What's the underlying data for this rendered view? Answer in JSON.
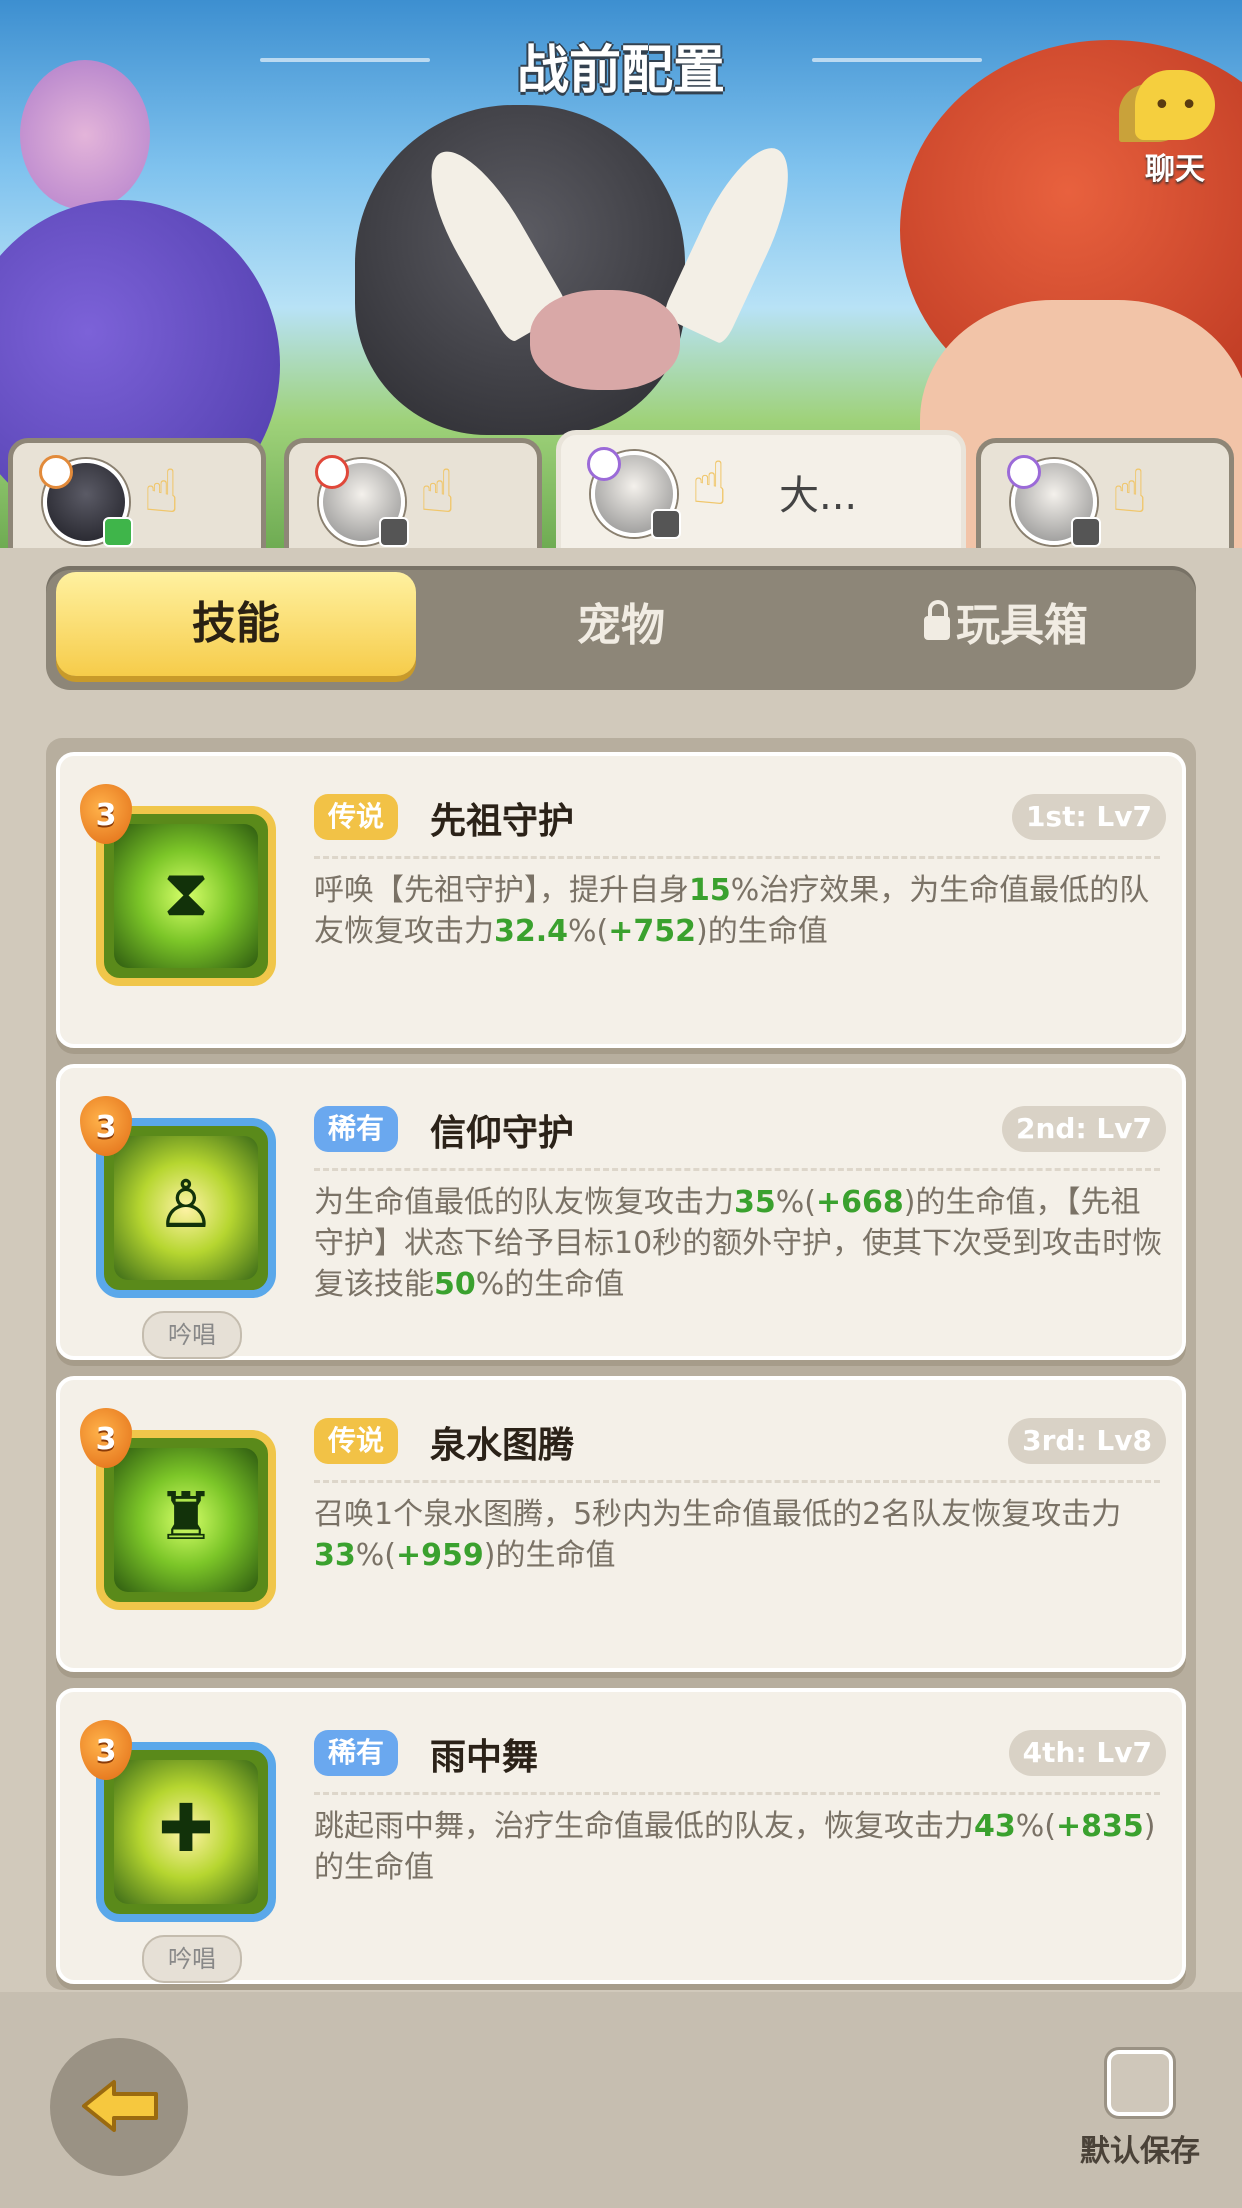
{
  "header": {
    "title": "战前配置",
    "chat_label": "聊天"
  },
  "hero_tabs": [
    {
      "name": ""
    },
    {
      "name": ""
    },
    {
      "name": "大..."
    },
    {
      "name": ""
    }
  ],
  "segment": {
    "skills": "技能",
    "pets": "宠物",
    "toybox": "玩具箱",
    "active": "技能"
  },
  "skills": [
    {
      "level": "3",
      "rarity": "传说",
      "name": "先祖守护",
      "slot": "1st: Lv7",
      "cast_tag": "",
      "desc": [
        "呼唤【先祖守护】，提升自身",
        {
          "g": "15"
        },
        "%治疗效果，为生命值最低的队友恢复攻击力",
        {
          "g": "32.4"
        },
        "%(",
        {
          "g": "+752"
        },
        ")的生命值"
      ]
    },
    {
      "level": "3",
      "rarity": "稀有",
      "name": "信仰守护",
      "slot": "2nd: Lv7",
      "cast_tag": "吟唱",
      "desc": [
        "为生命值最低的队友恢复攻击力",
        {
          "g": "35"
        },
        "%(",
        {
          "g": "+668"
        },
        ")的生命值，【先祖守护】状态下给予目标10秒的额外守护，使其下次受到攻击时恢复该技能",
        {
          "g": "50"
        },
        "%的生命值"
      ]
    },
    {
      "level": "3",
      "rarity": "传说",
      "name": "泉水图腾",
      "slot": "3rd: Lv8",
      "cast_tag": "",
      "desc": [
        "召唤1个泉水图腾，5秒内为生命值最低的2名队友恢复攻击力",
        {
          "g": "33"
        },
        "%(",
        {
          "g": "+959"
        },
        ")的生命值"
      ]
    },
    {
      "level": "3",
      "rarity": "稀有",
      "name": "雨中舞",
      "slot": "4th: Lv7",
      "cast_tag": "吟唱",
      "desc": [
        "跳起雨中舞，治疗生命值最低的队友，恢复攻击力",
        {
          "g": "43"
        },
        "%(",
        {
          "g": "+835"
        },
        ")的生命值"
      ]
    }
  ],
  "footer": {
    "save_label": "默认保存"
  },
  "colors": {
    "accent_yellow": "#f6cc4a",
    "legend": "#f2c246",
    "rare": "#6aa8ef",
    "highlight_green": "#3aa12e"
  }
}
